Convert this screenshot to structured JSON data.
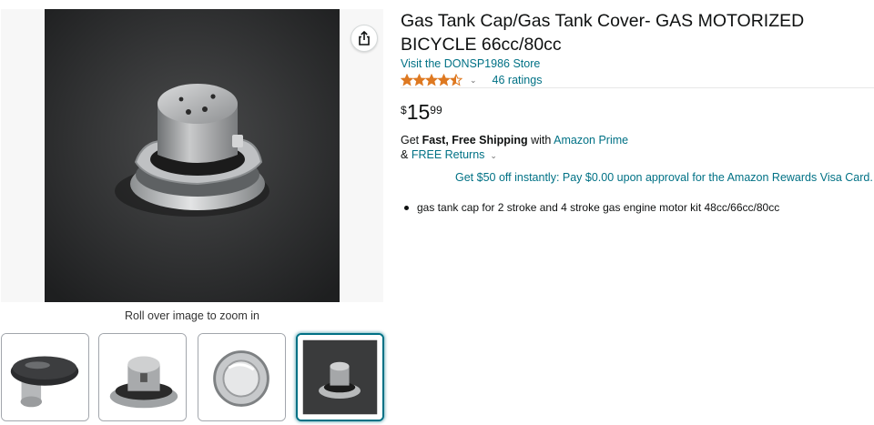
{
  "product": {
    "title": "Gas Tank Cap/Gas Tank Cover- GAS MOTORIZED BICYCLE 66cc/80cc",
    "store_link": "Visit the DONSP1986 Store",
    "rating": {
      "stars": 4.5,
      "count_label": "46 ratings"
    },
    "price": {
      "symbol": "$",
      "whole": "15",
      "fraction": "99"
    },
    "shipping": {
      "prefix": "Get ",
      "bold": "Fast, Free Shipping",
      "middle": " with ",
      "prime_link": "Amazon Prime"
    },
    "returns": {
      "prefix": "& ",
      "link": "FREE Returns"
    },
    "promo": "Get $50 off instantly: Pay $0.00 upon approval for the Amazon Rewards Visa Card.",
    "bullets": [
      "gas tank cap for 2 stroke and 4 stroke gas engine motor kit 48cc/66cc/80cc"
    ]
  },
  "gallery": {
    "zoom_hint": "Roll over image to zoom in",
    "selected_thumbnail": 4,
    "icons": {
      "share": "share-icon",
      "caret": "chevron-down-icon"
    }
  },
  "colors": {
    "link": "#007185",
    "star": "#de7921",
    "text": "#0f1111"
  }
}
